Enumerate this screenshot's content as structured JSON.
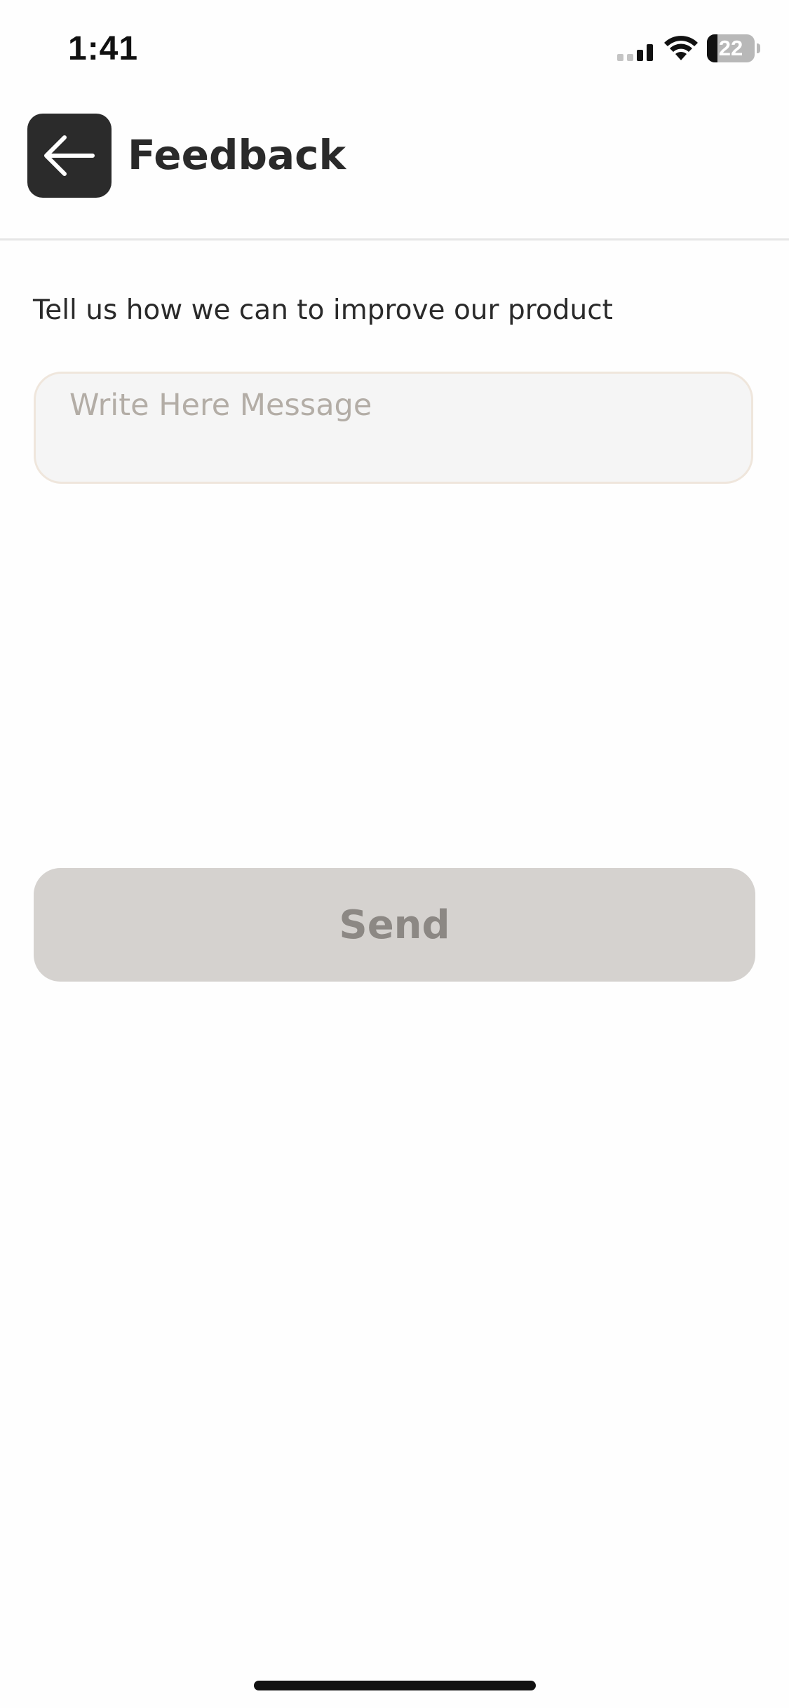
{
  "status_bar": {
    "time": "1:41",
    "battery_level": "22",
    "battery_fraction": 0.22,
    "signal_bars_active": 2,
    "signal_bars_total": 4
  },
  "header": {
    "title": "Feedback",
    "back_icon": "arrow-left-icon"
  },
  "form": {
    "prompt": "Tell us how we can to improve our product",
    "message_value": "",
    "message_placeholder": "Write Here Message",
    "send_label": "Send"
  },
  "colors": {
    "back_button_bg": "#2b2b2b",
    "field_bg": "#f5f5f5",
    "field_border": "#efe6dc",
    "send_button_bg": "#d5d2cf",
    "send_button_text": "#8c8884",
    "text_primary": "#2a2a2a"
  }
}
